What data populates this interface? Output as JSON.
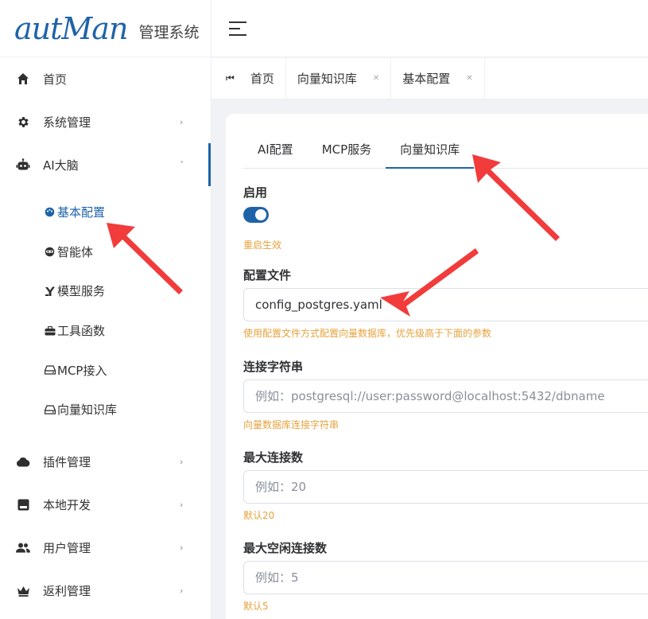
{
  "logo": {
    "mark": "autMan",
    "title": "管理系统"
  },
  "sidebar": {
    "items": [
      {
        "label": "首页"
      },
      {
        "label": "系统管理"
      },
      {
        "label": "AI大脑"
      },
      {
        "label": "插件管理"
      },
      {
        "label": "本地开发"
      },
      {
        "label": "用户管理"
      },
      {
        "label": "返利管理"
      }
    ],
    "ai_sub": [
      {
        "label": "基本配置"
      },
      {
        "label": "智能体"
      },
      {
        "label": "模型服务"
      },
      {
        "label": "工具函数"
      },
      {
        "label": "MCP接入"
      },
      {
        "label": "向量知识库"
      }
    ]
  },
  "tagbar": {
    "tags": [
      {
        "label": "首页"
      },
      {
        "label": "向量知识库"
      },
      {
        "label": "基本配置"
      }
    ]
  },
  "tabs": [
    {
      "label": "AI配置"
    },
    {
      "label": "MCP服务"
    },
    {
      "label": "向量知识库"
    }
  ],
  "form": {
    "enable": {
      "label": "启用",
      "on": true,
      "hint": "重启生效"
    },
    "config_file": {
      "label": "配置文件",
      "value": "config_postgres.yaml",
      "hint": "使用配置文件方式配置向量数据库，优先级高于下面的参数"
    },
    "conn_str": {
      "label": "连接字符串",
      "placeholder": "例如：postgresql://user:password@localhost:5432/dbname",
      "hint": "向量数据库连接字符串"
    },
    "max_conn": {
      "label": "最大连接数",
      "placeholder": "例如：20",
      "hint": "默认20"
    },
    "max_idle": {
      "label": "最大空闲连接数",
      "placeholder": "例如：5",
      "hint": "默认5"
    }
  },
  "colors": {
    "accent": "#1e63a8",
    "hint": "#e6a23c",
    "arrow": "#f23b3b"
  }
}
